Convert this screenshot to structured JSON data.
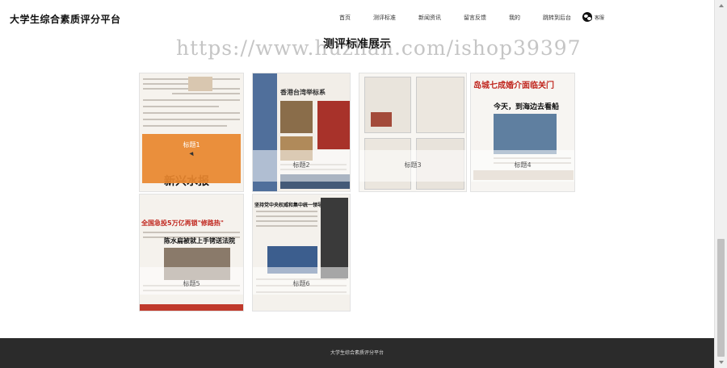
{
  "header": {
    "logo": "大学生综合素质评分平台",
    "nav": [
      "首页",
      "测评标准",
      "新闻资讯",
      "留言反馈",
      "我的",
      "跳转到后台"
    ],
    "wechat_label": "客服"
  },
  "main": {
    "title": "测评标准展示",
    "watermark": "https://www.huzhan.com/ishop39397",
    "cards": [
      {
        "label": "标题1",
        "active": true
      },
      {
        "label": "标题2"
      },
      {
        "label": "标题3"
      },
      {
        "label": "标题4"
      },
      {
        "label": "标题5"
      },
      {
        "label": "标题6"
      }
    ],
    "thumb_headlines": {
      "card2": "香港台湾举标系",
      "card4_a": "岛城七成婚介面临关门",
      "card4_b": "今天，到海边去看船",
      "card5_a": "新兴水报",
      "card5_b": "全国急投5万亿再锁\"修路热\"",
      "card5_c": "陈水扁被就上手铐送法院",
      "card6": "坚持党中央权威和集中统一领导"
    }
  },
  "footer": {
    "text": "大学生综合素质评分平台"
  },
  "colors": {
    "active_overlay": "#e8862e",
    "footer_bg": "#2b2b2b"
  }
}
